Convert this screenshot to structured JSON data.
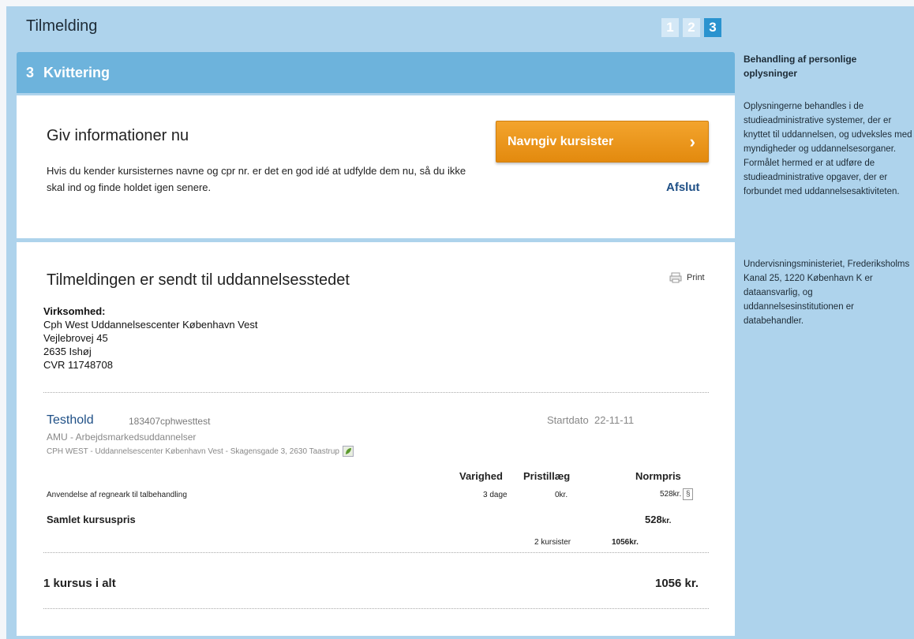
{
  "header": {
    "title": "Tilmelding",
    "steps": [
      "1",
      "2",
      "3"
    ],
    "active_step": "3"
  },
  "step_header": {
    "number": "3",
    "title": "Kvittering"
  },
  "info_panel": {
    "title": "Giv informationer nu",
    "text": "Hvis du kender kursisternes navne og cpr nr. er det en god idé at udfylde dem nu, så du ikke skal ind og finde holdet igen senere.",
    "cta_label": "Navngiv kursister",
    "cta_icon": "chevron-right-icon",
    "finish_label": "Afslut"
  },
  "receipt": {
    "title": "Tilmeldingen er sendt til uddannelsesstedet",
    "print_label": "Print",
    "company": {
      "label": "Virksomhed:",
      "name": "Cph West Uddannelsescenter København Vest",
      "street": "Vejlebrovej 45",
      "city": "2635 Ishøj",
      "cvr": "CVR 11748708"
    },
    "course": {
      "name": "Testhold",
      "code": "183407cphwesttest",
      "start_label": "Startdato",
      "start_date": "22-11-11",
      "category": "AMU - Arbejdsmarkedsuddannelser",
      "location": "CPH WEST - Uddannelsescenter København Vest - Skagensgade 3, 2630 Taastrup"
    },
    "table": {
      "headers": {
        "duration": "Varighed",
        "surcharge": "Pristillæg",
        "price": "Normpris"
      },
      "row": {
        "name": "Anvendelse af regneark til talbehandling",
        "duration": "3 dage",
        "surcharge": "0kr.",
        "price": "528kr."
      },
      "total_label": "Samlet kursuspris",
      "total_value": "528",
      "total_unit": "kr.",
      "participants": "2 kursister",
      "participants_total": "1056kr."
    },
    "summary": {
      "label": "1 kursus i alt",
      "value": "1056 kr."
    }
  },
  "sidebar": {
    "title": "Behandling af personlige oplysninger",
    "paragraph1": "Oplysningerne behandles i de studieadministrative systemer, der er knyttet til uddannelsen, og udveksles med myndigheder og uddannelsesorganer. Formålet hermed er at udføre de studieadministrative opgaver, der er forbundet med uddannelsesaktiviteten.",
    "paragraph2": "Undervisningsministeriet, Frederiksholms Kanal 25, 1220 København K er dataansvarlig, og uddannelsesinstitutionen er databehandler."
  }
}
